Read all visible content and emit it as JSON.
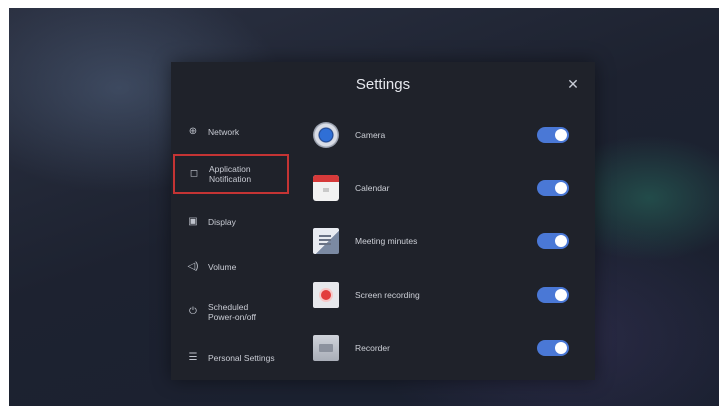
{
  "dialog": {
    "title": "Settings",
    "close_glyph": "✕"
  },
  "sidebar": {
    "items": [
      {
        "icon": "globe-icon",
        "glyph": "⊕",
        "label": "Network"
      },
      {
        "icon": "app-notification-icon",
        "glyph": "◻",
        "label": "Application Notification",
        "active": true
      },
      {
        "icon": "display-icon",
        "glyph": "▣",
        "label": "Display"
      },
      {
        "icon": "volume-icon",
        "glyph": "◁)",
        "label": "Volume"
      },
      {
        "icon": "schedule-power-icon",
        "glyph": "⏻",
        "label": "Scheduled Power-on/off"
      },
      {
        "icon": "settings-list-icon",
        "glyph": "☰",
        "label": "Personal Settings"
      }
    ]
  },
  "apps": [
    {
      "icon": "camera-icon",
      "name": "Camera",
      "enabled": true
    },
    {
      "icon": "calendar-icon",
      "name": "Calendar",
      "enabled": true
    },
    {
      "icon": "meeting-minutes-icon",
      "name": "Meeting minutes",
      "enabled": true
    },
    {
      "icon": "screen-recording-icon",
      "name": "Screen recording",
      "enabled": true
    },
    {
      "icon": "recorder-icon",
      "name": "Recorder",
      "enabled": true
    }
  ],
  "colors": {
    "toggle_on": "#4a78d6",
    "active_border": "#c43434",
    "dialog_bg": "#1f222a"
  }
}
